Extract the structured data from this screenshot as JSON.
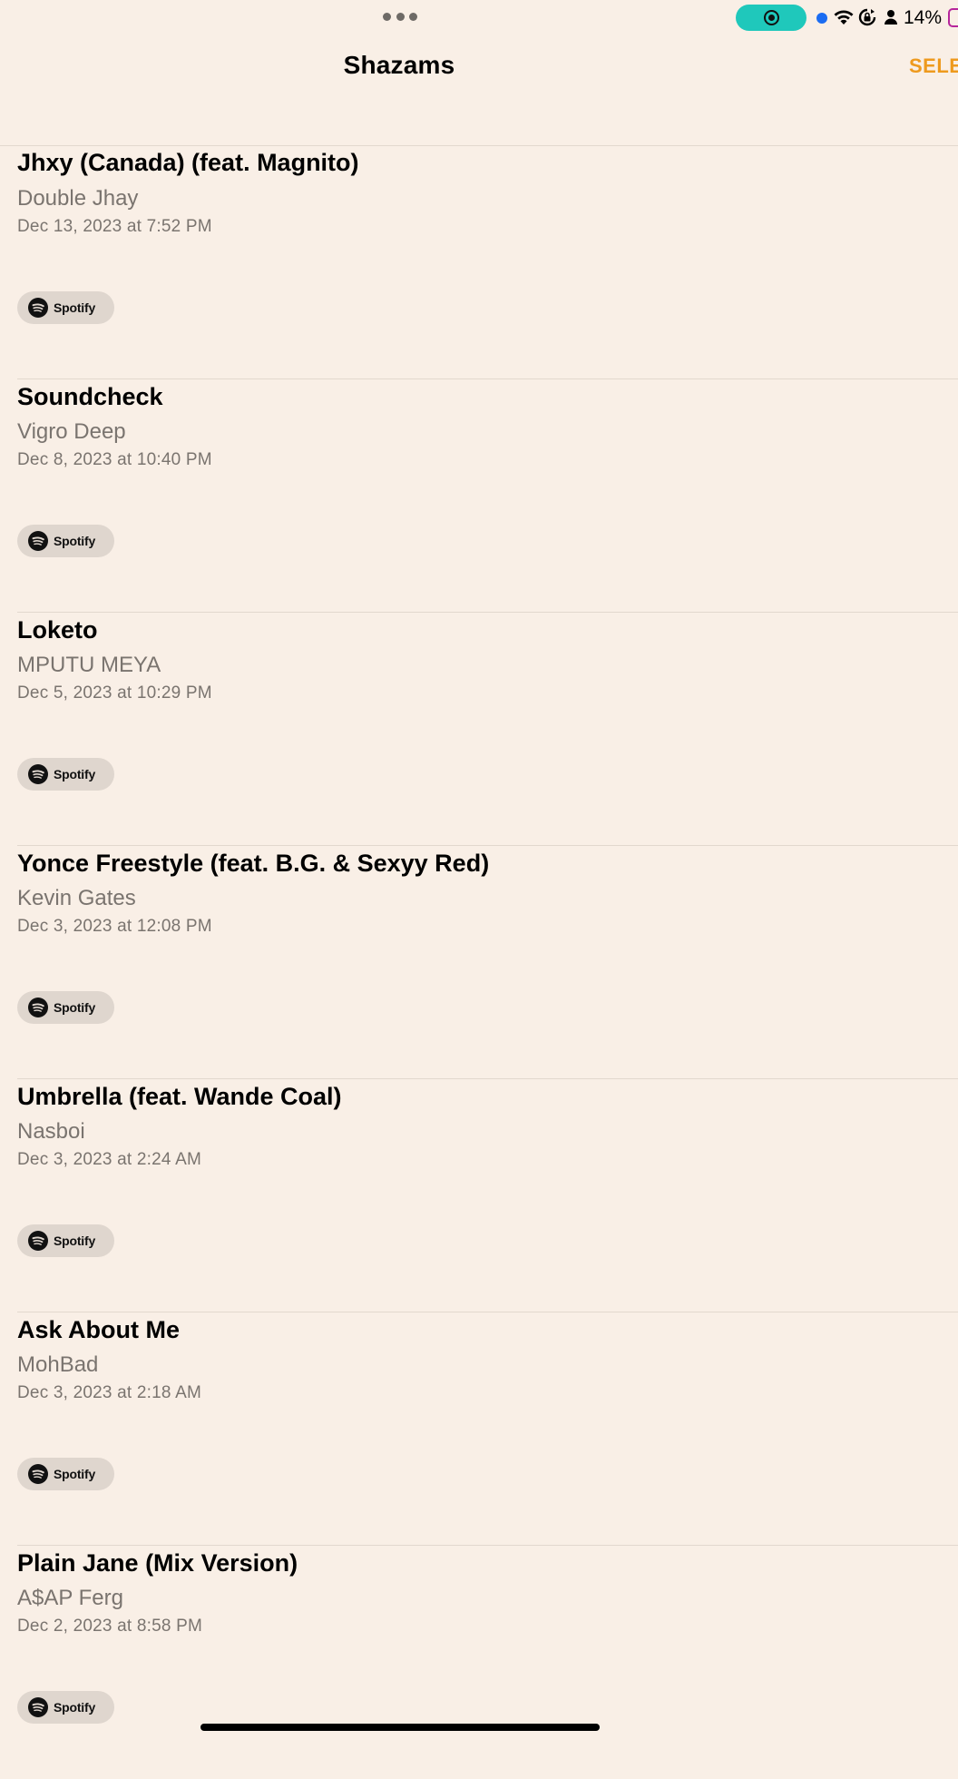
{
  "status_bar": {
    "battery_percent": "14%",
    "screen_record_color": "#1fc8bb",
    "battery_color": "#b6259c"
  },
  "nav": {
    "title": "Shazams",
    "select_label": "SELE",
    "accent_color": "#ee9a1e"
  },
  "shazams": [
    {
      "title": "Jhxy (Canada) (feat. Magnito)",
      "artist": "Double Jhay",
      "date": "Dec 13, 2023 at 7:52 PM",
      "service": "Spotify"
    },
    {
      "title": "Soundcheck",
      "artist": "Vigro Deep",
      "date": "Dec 8, 2023 at 10:40 PM",
      "service": "Spotify"
    },
    {
      "title": "Loketo",
      "artist": "MPUTU MEYA",
      "date": "Dec 5, 2023 at 10:29 PM",
      "service": "Spotify"
    },
    {
      "title": "Yonce Freestyle (feat. B.G. & Sexyy Red)",
      "artist": "Kevin Gates",
      "date": "Dec 3, 2023 at 12:08 PM",
      "service": "Spotify"
    },
    {
      "title": "Umbrella (feat. Wande Coal)",
      "artist": "Nasboi",
      "date": "Dec 3, 2023 at 2:24 AM",
      "service": "Spotify"
    },
    {
      "title": "Ask About Me",
      "artist": "MohBad",
      "date": "Dec 3, 2023 at 2:18 AM",
      "service": "Spotify"
    },
    {
      "title": "Plain Jane (Mix Version)",
      "artist": "A$AP Ferg",
      "date": "Dec 2, 2023 at 8:58 PM",
      "service": "Spotify"
    }
  ]
}
